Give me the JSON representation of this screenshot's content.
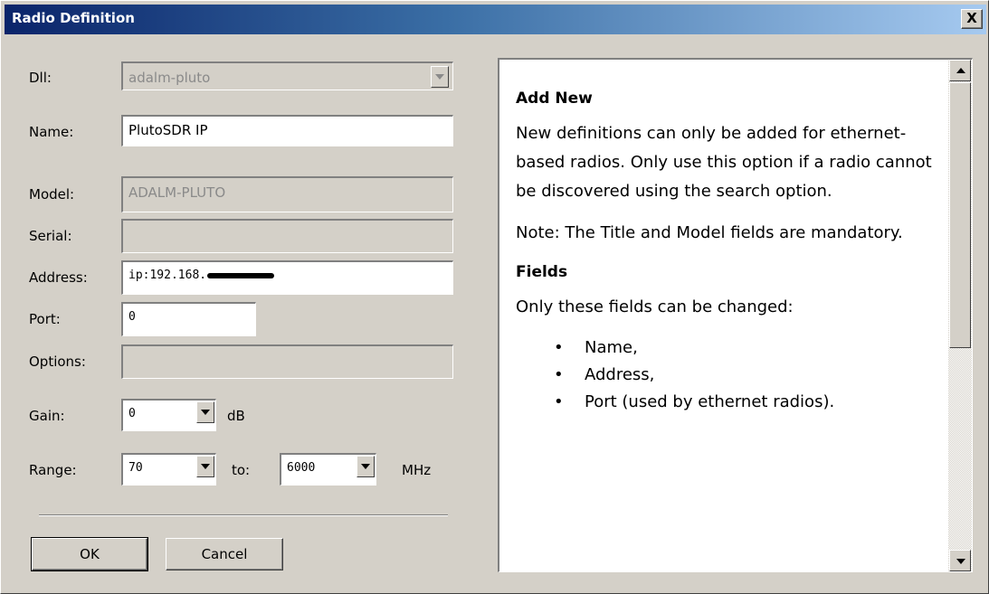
{
  "window": {
    "title": "Radio Definition",
    "close_label": "X"
  },
  "form": {
    "dll": {
      "label": "Dll:",
      "value": "adalm-pluto"
    },
    "name": {
      "label": "Name:",
      "value": "PlutoSDR IP"
    },
    "model": {
      "label": "Model:",
      "value": "ADALM-PLUTO"
    },
    "serial": {
      "label": "Serial:",
      "value": ""
    },
    "address": {
      "label": "Address:",
      "value": "ip:192.168."
    },
    "port": {
      "label": "Port:",
      "value": "0"
    },
    "options": {
      "label": "Options:",
      "value": ""
    },
    "gain": {
      "label": "Gain:",
      "value": "0",
      "unit": "dB"
    },
    "range": {
      "label": "Range:",
      "from": "70",
      "to_label": "to:",
      "to": "6000",
      "unit": "MHz"
    }
  },
  "buttons": {
    "ok": "OK",
    "cancel": "Cancel"
  },
  "help": {
    "heading_add": "Add New",
    "para_add": "New definitions can only be added for ethernet-based radios. Only use this option if a radio cannot be discovered using the search option.",
    "para_note": "Note: The Title and Model fields are mandatory.",
    "heading_fields": "Fields",
    "para_fields": "Only these fields can be changed:",
    "bullet": "•",
    "items": [
      "Name,",
      "Address,",
      "Port (used by ethernet radios)."
    ]
  },
  "icons": [
    "close-icon",
    "dropdown-arrow-icon",
    "scroll-up-icon",
    "scroll-down-icon"
  ]
}
